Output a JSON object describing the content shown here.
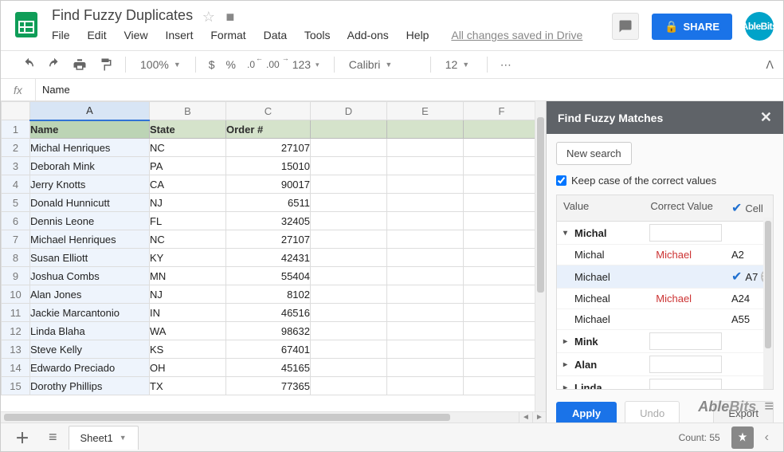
{
  "doc": {
    "name": "Find Fuzzy Duplicates",
    "save_status": "All changes saved in Drive"
  },
  "share_label": "SHARE",
  "avatar_label": "AbleBits",
  "menu": {
    "file": "File",
    "edit": "Edit",
    "view": "View",
    "insert": "Insert",
    "format": "Format",
    "data": "Data",
    "tools": "Tools",
    "addons": "Add-ons",
    "help": "Help"
  },
  "toolbar": {
    "zoom": "100%",
    "font": "Calibri",
    "size": "12",
    "numfmt": "123",
    "currency": "$",
    "percent": "%",
    "dec_less": ".0",
    "dec_more": ".00"
  },
  "formula_bar": "Name",
  "columns": [
    "A",
    "B",
    "C",
    "D",
    "E",
    "F"
  ],
  "header_row": {
    "A": "Name",
    "B": "State",
    "C": "Order #"
  },
  "rows": [
    {
      "A": "Michal Henriques",
      "B": "NC",
      "C": "27107"
    },
    {
      "A": "Deborah Mink",
      "B": "PA",
      "C": "15010"
    },
    {
      "A": "Jerry Knotts",
      "B": "CA",
      "C": "90017"
    },
    {
      "A": "Donald Hunnicutt",
      "B": "NJ",
      "C": "6511"
    },
    {
      "A": "Dennis Leone",
      "B": "FL",
      "C": "32405"
    },
    {
      "A": "Michael Henriques",
      "B": "NC",
      "C": "27107"
    },
    {
      "A": "Susan Elliott",
      "B": "KY",
      "C": "42431"
    },
    {
      "A": "Joshua Combs",
      "B": "MN",
      "C": "55404"
    },
    {
      "A": "Alan Jones",
      "B": "NJ",
      "C": "8102"
    },
    {
      "A": "Jackie Marcantonio",
      "B": "IN",
      "C": "46516"
    },
    {
      "A": "Linda Blaha",
      "B": "WA",
      "C": "98632"
    },
    {
      "A": "Steve Kelly",
      "B": "KS",
      "C": "67401"
    },
    {
      "A": "Edwardo Preciado",
      "B": "OH",
      "C": "45165"
    },
    {
      "A": "Dorothy Phillips",
      "B": "TX",
      "C": "77365"
    }
  ],
  "sheet_tab": "Sheet1",
  "count_label": "Count: 55",
  "panel": {
    "title": "Find Fuzzy Matches",
    "new_search": "New search",
    "keep_case": "Keep case of the correct values",
    "col_value": "Value",
    "col_correct": "Correct Value",
    "col_cell": "Cell",
    "groups": [
      {
        "name": "Michal",
        "expanded": true,
        "children": [
          {
            "value": "Michal",
            "correct": "Michael",
            "cell": "A2",
            "sel": false,
            "chk": false
          },
          {
            "value": "Michael",
            "correct": "",
            "cell": "A7",
            "sel": true,
            "chk": true
          },
          {
            "value": "Micheal",
            "correct": "Michael",
            "cell": "A24",
            "sel": false,
            "chk": false
          },
          {
            "value": "Michael",
            "correct": "",
            "cell": "A55",
            "sel": false,
            "chk": false
          }
        ]
      },
      {
        "name": "Mink",
        "expanded": false
      },
      {
        "name": "Alan",
        "expanded": false
      },
      {
        "name": "Linda",
        "expanded": false
      }
    ],
    "apply": "Apply",
    "undo": "Undo",
    "export": "Export",
    "brand": "AbleBits"
  }
}
